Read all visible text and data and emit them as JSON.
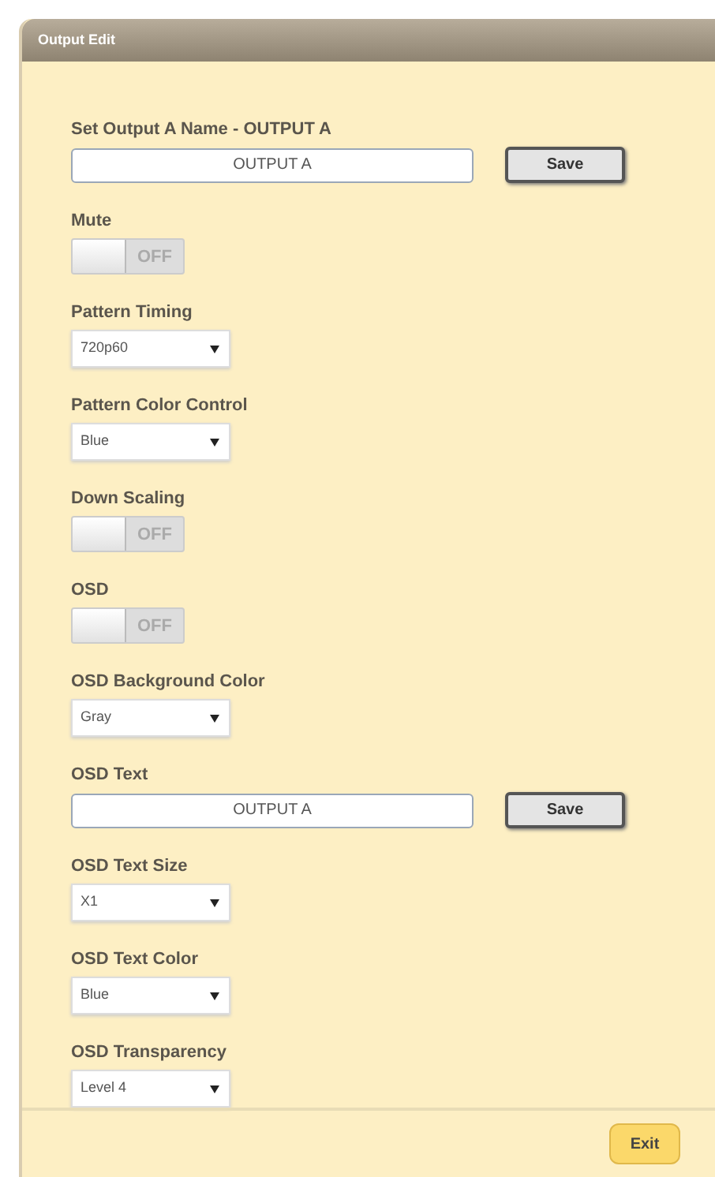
{
  "window": {
    "title": "Output Edit"
  },
  "fields": [
    {
      "kind": "text",
      "label": "Set Output A Name - OUTPUT A",
      "value": "OUTPUT A",
      "button": "Save"
    },
    {
      "kind": "toggle",
      "label": "Mute",
      "on": false,
      "state_text": "OFF"
    },
    {
      "kind": "select",
      "label": "Pattern Timing",
      "value": "720p60"
    },
    {
      "kind": "select",
      "label": "Pattern Color Control",
      "value": "Blue"
    },
    {
      "kind": "toggle",
      "label": "Down Scaling",
      "on": false,
      "state_text": "OFF"
    },
    {
      "kind": "toggle",
      "label": "OSD",
      "on": false,
      "state_text": "OFF"
    },
    {
      "kind": "select",
      "label": "OSD Background Color",
      "value": "Gray"
    },
    {
      "kind": "text",
      "label": "OSD Text",
      "value": "OUTPUT A",
      "button": "Save"
    },
    {
      "kind": "select",
      "label": "OSD Text Size",
      "value": "X1"
    },
    {
      "kind": "select",
      "label": "OSD Text Color",
      "value": "Blue"
    },
    {
      "kind": "select",
      "label": "OSD Transparency",
      "value": "Level 4"
    }
  ],
  "footer": {
    "button": "Exit"
  }
}
